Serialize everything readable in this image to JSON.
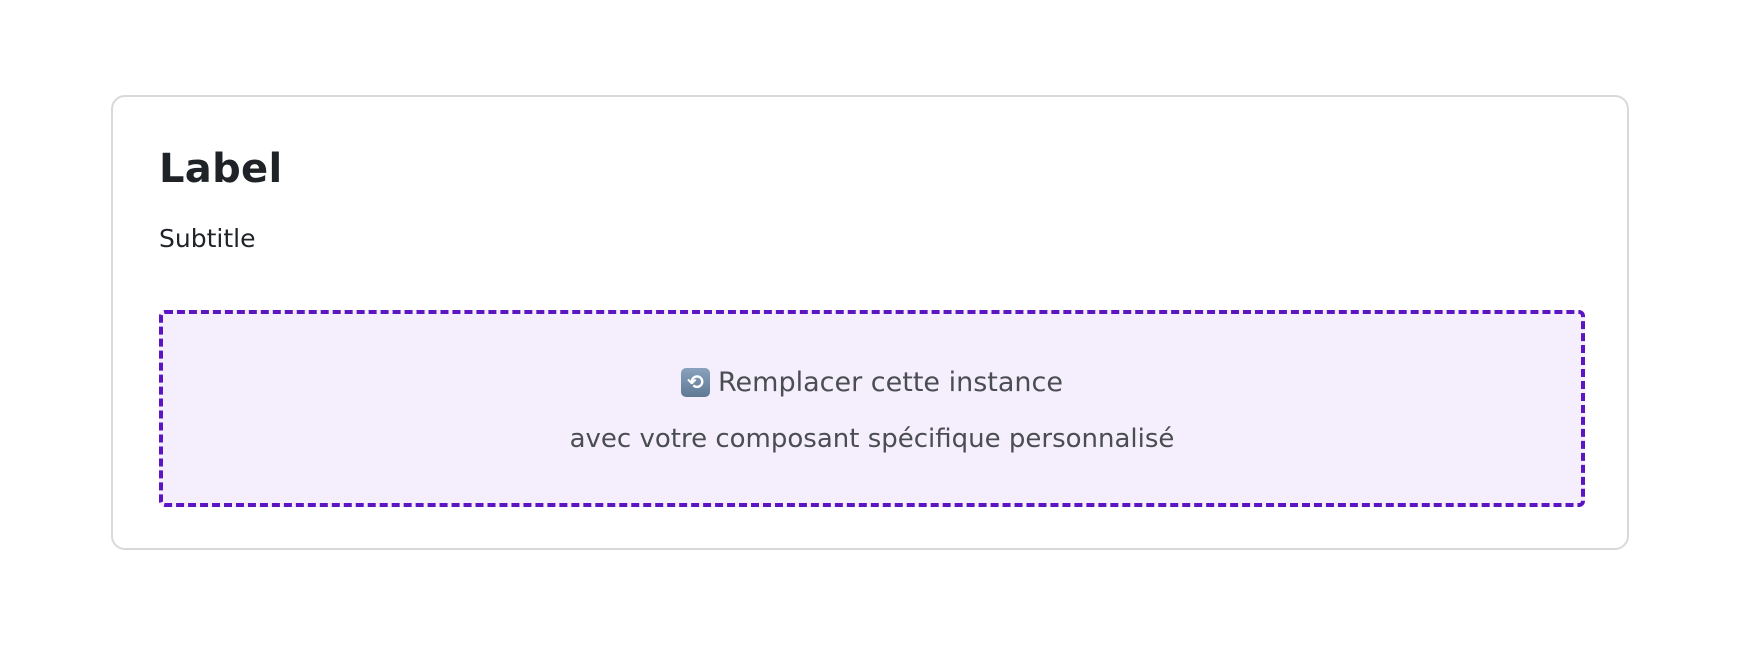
{
  "card": {
    "title": "Label",
    "subtitle": "Subtitle"
  },
  "placeholder": {
    "icon": "refresh-icon",
    "line1": "Remplacer cette instance",
    "line2": "avec votre composant spécifique personnalisé"
  },
  "colors": {
    "accent": "#5b16c2",
    "placeholder_bg": "#f5effd",
    "title_text": "#1f2327",
    "body_text": "#4a4d52",
    "card_border": "#d9d9dc"
  }
}
